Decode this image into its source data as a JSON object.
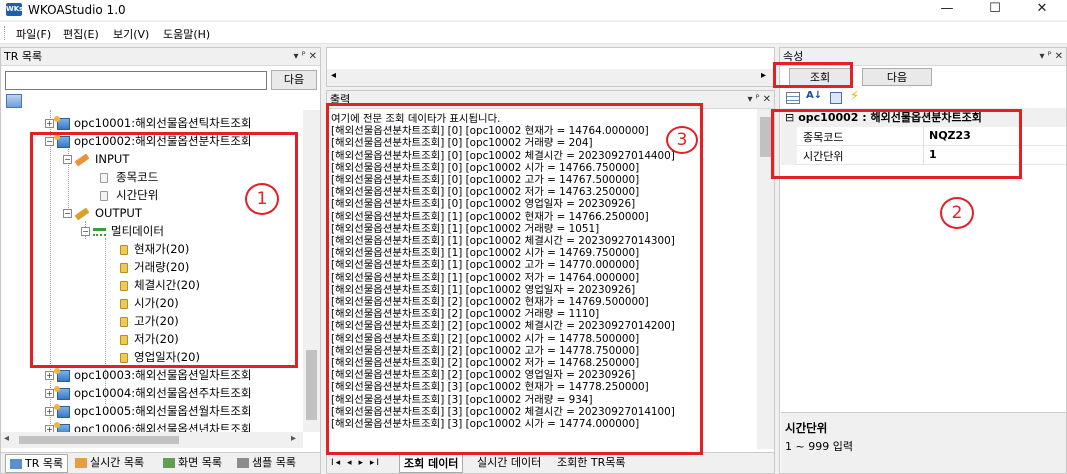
{
  "app": {
    "icon_label": "WKs",
    "title": "WKOAStudio 1.0",
    "minimize": "—",
    "maximize": "☐",
    "close": "✕"
  },
  "menu": [
    "파일(F)",
    "편집(E)",
    "보기(V)",
    "도움말(H)"
  ],
  "tr_panel": {
    "title": "TR 목록",
    "header_icons": "▾ ᴾ ✕",
    "next_button": "다음",
    "search_value": "",
    "tree": {
      "item1": "opc10001:해외선물옵션틱차트조회",
      "item2": "opc10002:해외선물옵션분차트조회",
      "input": "INPUT",
      "input_fields": [
        "종목코드",
        "시간단위"
      ],
      "output": "OUTPUT",
      "multi": "멀티데이터",
      "output_fields": [
        "현재가(20)",
        "거래량(20)",
        "체결시간(20)",
        "시가(20)",
        "고가(20)",
        "저가(20)",
        "영업일자(20)"
      ],
      "item3": "opc10003:해외선물옵션일차트조회",
      "item4": "opc10004:해외선물옵션주차트조회",
      "item5": "opc10005:해외선물옵션월차트조회",
      "item6": "opc10006:해외선물옵션년차트조회"
    },
    "bottom_tabs": [
      "TR 목록",
      "실시간 목록",
      "화면 목록",
      "샘플 목록"
    ]
  },
  "output_panel": {
    "title": "출력",
    "header_icons": "▾ ᴾ ✕",
    "lines": [
      "여기에 전문 조회 데이타가 표시됩니다.",
      "[해외선물옵션분차트조회] [0] [opc10002 현재가 = 14764.000000]",
      "[해외선물옵션분차트조회] [0] [opc10002 거래량 = 204]",
      "[해외선물옵션분차트조회] [0] [opc10002 체결시간 = 20230927014400]",
      "[해외선물옵션분차트조회] [0] [opc10002 시가 = 14766.750000]",
      "[해외선물옵션분차트조회] [0] [opc10002 고가 = 14767.500000]",
      "[해외선물옵션분차트조회] [0] [opc10002 저가 = 14763.250000]",
      "[해외선물옵션분차트조회] [0] [opc10002 영업일자 = 20230926]",
      "[해외선물옵션분차트조회] [1] [opc10002 현재가 = 14766.250000]",
      "[해외선물옵션분차트조회] [1] [opc10002 거래량 = 1051]",
      "[해외선물옵션분차트조회] [1] [opc10002 체결시간 = 20230927014300]",
      "[해외선물옵션분차트조회] [1] [opc10002 시가 = 14769.750000]",
      "[해외선물옵션분차트조회] [1] [opc10002 고가 = 14770.000000]",
      "[해외선물옵션분차트조회] [1] [opc10002 저가 = 14764.000000]",
      "[해외선물옵션분차트조회] [1] [opc10002 영업일자 = 20230926]",
      "[해외선물옵션분차트조회] [2] [opc10002 현재가 = 14769.500000]",
      "[해외선물옵션분차트조회] [2] [opc10002 거래량 = 1110]",
      "[해외선물옵션분차트조회] [2] [opc10002 체결시간 = 20230927014200]",
      "[해외선물옵션분차트조회] [2] [opc10002 시가 = 14778.500000]",
      "[해외선물옵션분차트조회] [2] [opc10002 고가 = 14778.750000]",
      "[해외선물옵션분차트조회] [2] [opc10002 저가 = 14768.250000]",
      "[해외선물옵션분차트조회] [2] [opc10002 영업일자 = 20230926]",
      "[해외선물옵션분차트조회] [3] [opc10002 현재가 = 14778.250000]",
      "[해외선물옵션분차트조회] [3] [opc10002 거래량 = 934]",
      "[해외선물옵션분차트조회] [3] [opc10002 체결시간 = 20230927014100]",
      "[해외선물옵션분차트조회] [3] [opc10002 시가 = 14774.000000]"
    ],
    "bottom_tabs": [
      "조회 데이터",
      "실시간 데이터",
      "조회한 TR목록"
    ],
    "nav": [
      "I◂",
      "◂",
      "▸",
      "▸I"
    ]
  },
  "props_panel": {
    "title": "속성",
    "header_icons": "▾ ᴾ ✕",
    "query_button": "조회",
    "next_button": "다음",
    "category": "opc10002 : 해외선물옵션분차트조회",
    "rows": [
      {
        "name": "종목코드",
        "value": "NQZ23"
      },
      {
        "name": "시간단위",
        "value": "1"
      }
    ],
    "help_title": "시간단위",
    "help_text": "1 ~ 999 입력"
  },
  "annotations": [
    "1",
    "2",
    "3"
  ],
  "accent_color": "#e41f26"
}
